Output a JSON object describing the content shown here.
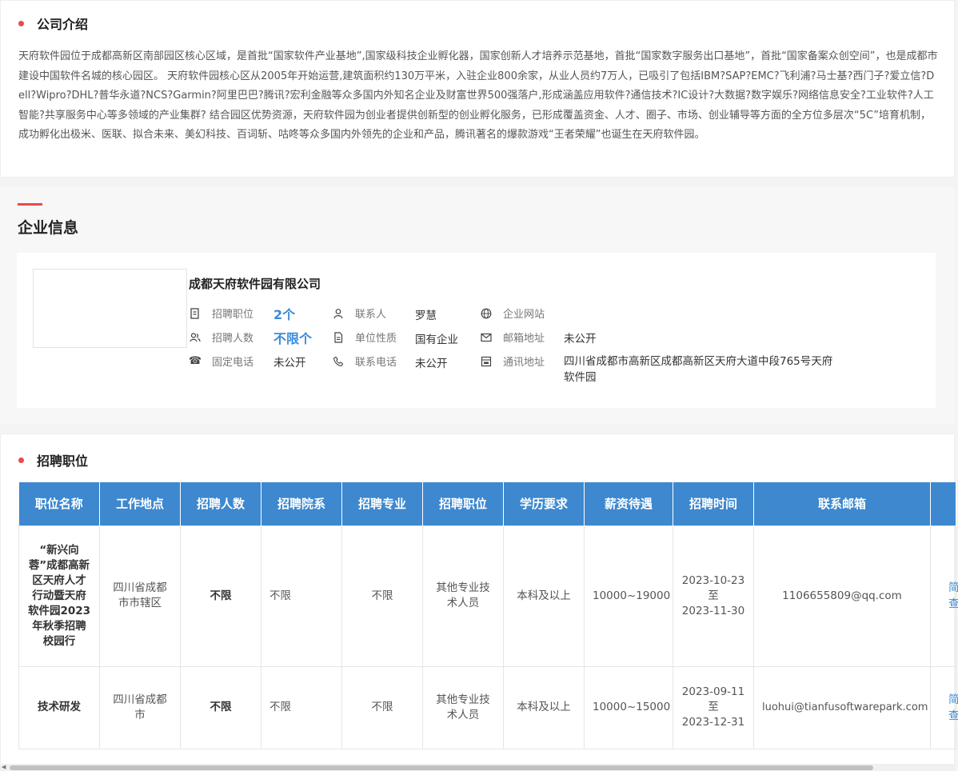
{
  "intro": {
    "title": "公司介绍",
    "text": "天府软件园位于成都高新区南部园区核心区域，是首批“国家软件产业基地”,国家级科技企业孵化器，国家创新人才培养示范基地，首批“国家数字服务出口基地”，首批“国家备案众创空间”，也是成都市建设中国软件名城的核心园区。 天府软件园核心区从2005年开始运营,建筑面积约130万平米，入驻企业800余家，从业人员约7万人，已吸引了包括IBM?SAP?EMC?飞利浦?马士基?西门子?爱立信?Dell?Wipro?DHL?普华永道?NCS?Garmin?阿里巴巴?腾讯?宏利金融等众多国内外知名企业及财富世界500强落户,形成涵盖应用软件?通信技术?IC设计?大数据?数字娱乐?网络信息安全?工业软件?人工智能?共享服务中心等多领域的产业集群? 结合园区优势资源，天府软件园为创业者提供创新型的创业孵化服务，已形成覆盖资金、人才、圈子、市场、创业辅导等方面的全方位多层次“5C”培育机制，成功孵化出极米、医联、拟合未来、美幻科技、百词斩、咕咚等众多国内外领先的企业和产品，腾讯著名的爆款游戏“王者荣耀”也诞生在天府软件园。"
  },
  "enterprise": {
    "heading": "企业信息",
    "company_name": "成都天府软件园有限公司",
    "fields": {
      "jobs_label": "招聘职位",
      "jobs_value": "2个",
      "headcount_label": "招聘人数",
      "headcount_value": "不限个",
      "phone_label": "固定电话",
      "phone_value": "未公开",
      "contact_label": "联系人",
      "contact_value": "罗慧",
      "nature_label": "单位性质",
      "nature_value": "国有企业",
      "mobile_label": "联系电话",
      "mobile_value": "未公开",
      "website_label": "企业网站",
      "website_value": "",
      "email_label": "邮箱地址",
      "email_value": "未公开",
      "address_label": "通讯地址",
      "address_value": "四川省成都市高新区成都高新区天府大道中段765号天府软件园"
    }
  },
  "jobs": {
    "title": "招聘职位",
    "headers": [
      "职位名称",
      "工作地点",
      "招聘人数",
      "招聘院系",
      "招聘专业",
      "招聘职位",
      "学历要求",
      "薪资待遇",
      "招聘时间",
      "联系邮箱",
      ""
    ],
    "rows": [
      {
        "name": "“新兴向蓉”成都高新区天府人才行动暨天府软件园2023年秋季招聘校园行",
        "location": "四川省成都市市辖区",
        "count": "不限",
        "dept": "不限",
        "major": "不限",
        "position": "其他专业技术人员",
        "education": "本科及以上",
        "salary": "10000~19000",
        "time_start": "2023-10-23",
        "time_to": "至",
        "time_end": "2023-11-30",
        "email": "1106655809@qq.com",
        "action": "简查"
      },
      {
        "name": "技术研发",
        "location": "四川省成都市",
        "count": "不限",
        "dept": "不限",
        "major": "不限",
        "position": "其他专业技术人员",
        "education": "本科及以上",
        "salary": "10000~15000",
        "time_start": "2023-09-11",
        "time_to": "至",
        "time_end": "2023-12-31",
        "email": "luohui@tianfusoftwarepark.com",
        "action": "简查"
      }
    ]
  },
  "colors": {
    "accent": "#e94a4a",
    "table_header": "#3d88cf",
    "link": "#3b8ad9"
  }
}
